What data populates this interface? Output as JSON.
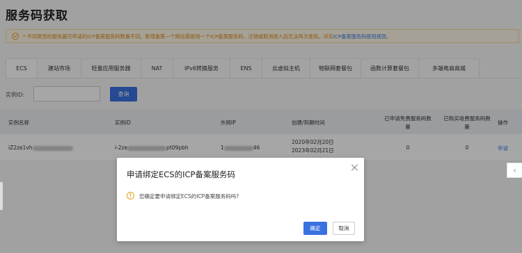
{
  "page": {
    "title": "服务码获取"
  },
  "notice": {
    "text": "* 不同类型的服务器可申请的ICP备案服务码数量不同。新增备案一个网站需使用一个ICP备案服务码，注销或取消接入后无法再次使用。详见",
    "link": "ICP备案服务码使用规则",
    "suffix": "。",
    "icon": "chevron-down-icon"
  },
  "tabs": [
    {
      "label": "ECS"
    },
    {
      "label": "建站市场"
    },
    {
      "label": "轻量应用服务器"
    },
    {
      "label": "NAT"
    },
    {
      "label": "IPv6转换服务"
    },
    {
      "label": "ENS"
    },
    {
      "label": "云虚拟主机"
    },
    {
      "label": "物联网套餐包"
    },
    {
      "label": "函数计算套餐包"
    },
    {
      "label": "多端电商商城"
    }
  ],
  "search": {
    "label": "实例ID:",
    "value": "",
    "button": "查询"
  },
  "table": {
    "headers": {
      "name": "实例名称",
      "id": "实例ID",
      "ip": "外网IP",
      "time": "创建/到期时间",
      "free_line1": "已申请免费服务码数",
      "free_line2": "量",
      "paid_line1": "已购买收费服务码数",
      "paid_line2": "量",
      "action": "操作"
    },
    "rows": [
      {
        "name_prefix": "iZ2ze1vh",
        "id_prefix": "i-2ze",
        "id_suffix": "pt09pbh",
        "ip_prefix": "1",
        "ip_suffix": "46",
        "created": "2020年02月20日",
        "expires": "2023年02月21日",
        "free_count": "0",
        "paid_count": "0",
        "action": "申请"
      }
    ]
  },
  "modal": {
    "title": "申请绑定ECS的ICP备案服务码",
    "message": "您确定要申请绑定ECS的ICP备案服务码吗?",
    "icon_glyph": "!",
    "ok": "确定",
    "cancel": "取消"
  },
  "colors": {
    "primary": "#3a71e0",
    "warning": "#e49b2b",
    "link": "#3a7de0"
  }
}
